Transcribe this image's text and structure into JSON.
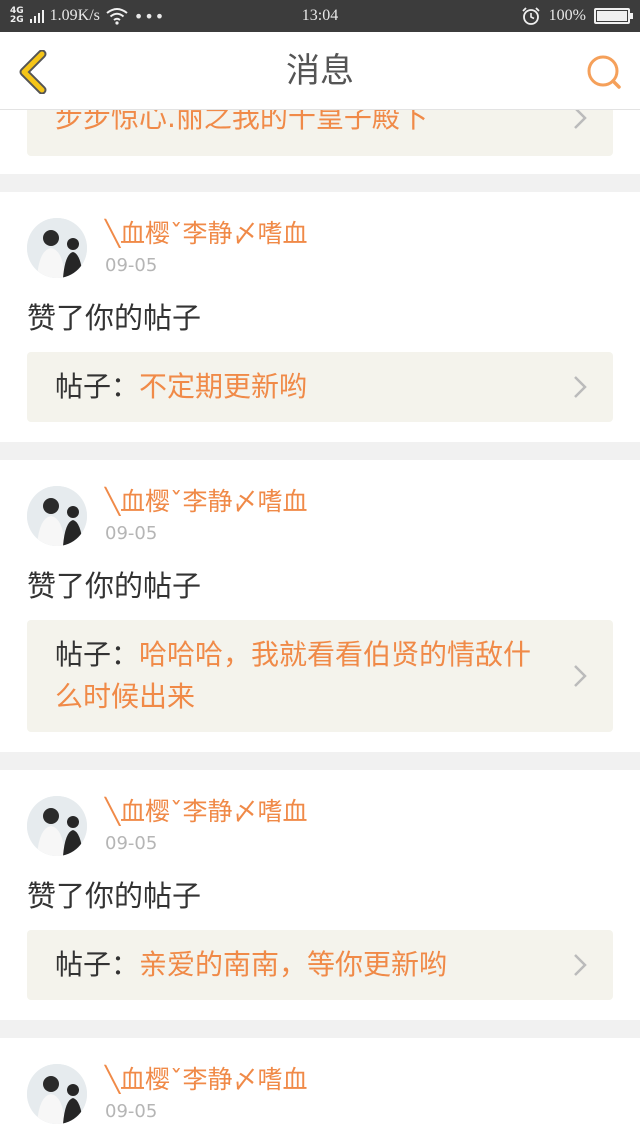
{
  "status_bar": {
    "network_top": "4G",
    "network_bottom": "2G",
    "speed": "1.09K/s",
    "more": "•••",
    "time": "13:04",
    "battery_text": "100%",
    "battery_level": 1.0
  },
  "nav": {
    "title": "消息",
    "back_icon": "chevron-left-icon",
    "search_icon": "search-icon",
    "accent": "#f5a623"
  },
  "top_card": {
    "post_title": "步步惊心.丽之我的十皇子殿下"
  },
  "notifications": [
    {
      "user": "╲血樱ˇ李静〆嗜血",
      "date": "09-05",
      "action": "赞了你的帖子",
      "post_prefix": "帖子：",
      "post_title": "不定期更新哟"
    },
    {
      "user": "╲血樱ˇ李静〆嗜血",
      "date": "09-05",
      "action": "赞了你的帖子",
      "post_prefix": "帖子：",
      "post_title": "哈哈哈，我就看看伯贤的情敌什么时候出来"
    },
    {
      "user": "╲血樱ˇ李静〆嗜血",
      "date": "09-05",
      "action": "赞了你的帖子",
      "post_prefix": "帖子：",
      "post_title": "亲爱的南南，等你更新哟"
    },
    {
      "user": "╲血樱ˇ李静〆嗜血",
      "date": "09-05"
    }
  ],
  "colors": {
    "username": "#f08a48",
    "post_title": "#f08a48",
    "post_box_bg": "#f4f3ec",
    "page_bg": "#f1f1f1"
  }
}
